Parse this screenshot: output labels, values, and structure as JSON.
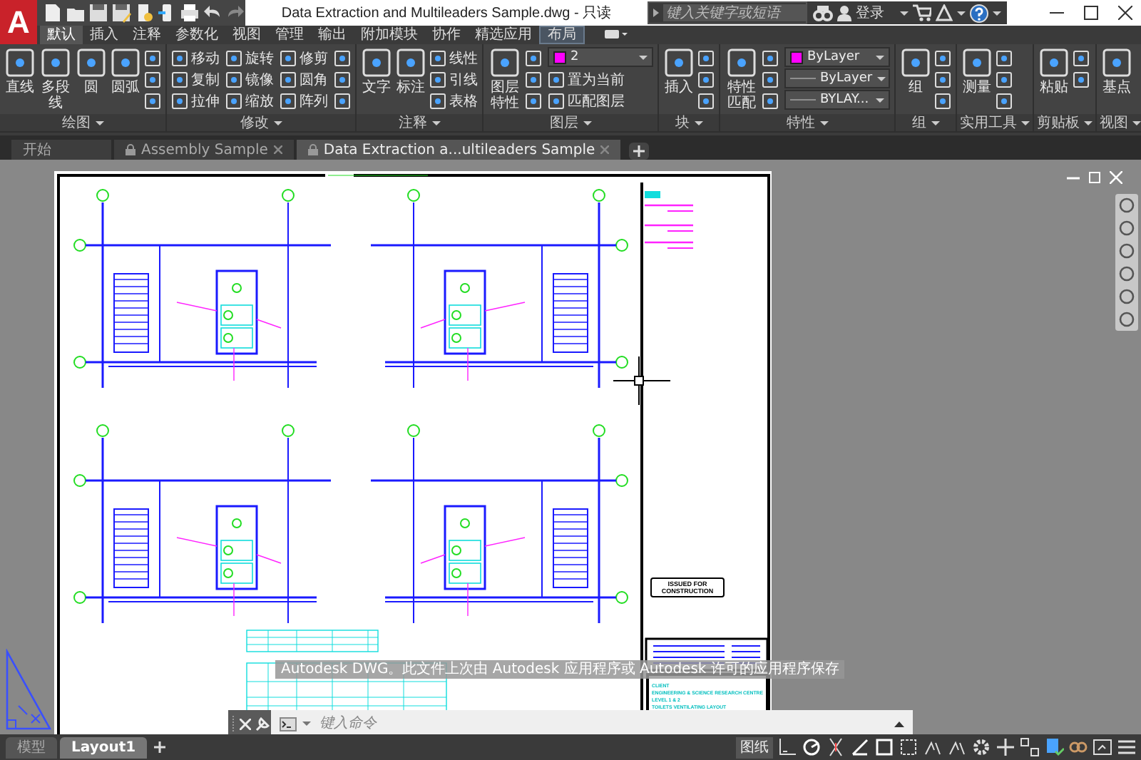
{
  "window": {
    "title": "Data Extraction and Multileaders Sample.dwg - 只读"
  },
  "app_button": {
    "label": "A"
  },
  "search": {
    "placeholder": "键入关键字或短语"
  },
  "sign_in": "登录",
  "ribbon_tabs": [
    {
      "label": "默认",
      "selected": true
    },
    {
      "label": "插入",
      "selected": false
    },
    {
      "label": "注释",
      "selected": false
    },
    {
      "label": "参数化",
      "selected": false
    },
    {
      "label": "视图",
      "selected": false
    },
    {
      "label": "管理",
      "selected": false
    },
    {
      "label": "输出",
      "selected": false
    },
    {
      "label": "附加模块",
      "selected": false
    },
    {
      "label": "协作",
      "selected": false
    },
    {
      "label": "精选应用",
      "selected": false
    },
    {
      "label": "布局",
      "selected": false,
      "contextual": true
    }
  ],
  "ribbon_panels": [
    {
      "title": "绘图",
      "tools": [
        {
          "kind": "large",
          "label": "直线"
        },
        {
          "kind": "large",
          "label": "多段线"
        },
        {
          "kind": "large",
          "label": "圆"
        },
        {
          "kind": "large",
          "label": "圆弧"
        },
        {
          "kind": "icon"
        },
        {
          "kind": "icon"
        },
        {
          "kind": "icon"
        }
      ]
    },
    {
      "title": "修改",
      "tools": [
        {
          "kind": "small",
          "label": "移动"
        },
        {
          "kind": "small",
          "label": "复制"
        },
        {
          "kind": "small",
          "label": "拉伸"
        },
        {
          "kind": "small",
          "label": "旋转"
        },
        {
          "kind": "small",
          "label": "镜像"
        },
        {
          "kind": "small",
          "label": "缩放"
        },
        {
          "kind": "small",
          "label": "修剪"
        },
        {
          "kind": "small",
          "label": "圆角"
        },
        {
          "kind": "small",
          "label": "阵列"
        },
        {
          "kind": "icon"
        },
        {
          "kind": "icon"
        },
        {
          "kind": "icon"
        }
      ]
    },
    {
      "title": "注释",
      "tools": [
        {
          "kind": "large",
          "label": "文字"
        },
        {
          "kind": "large",
          "label": "标注"
        },
        {
          "kind": "small",
          "label": "线性"
        },
        {
          "kind": "small",
          "label": "引线"
        },
        {
          "kind": "small",
          "label": "表格"
        }
      ]
    },
    {
      "title": "图层",
      "tools": [
        {
          "kind": "large",
          "label": "图层特性"
        },
        {
          "kind": "icon"
        },
        {
          "kind": "icon"
        },
        {
          "kind": "icon"
        },
        {
          "kind": "dropdown",
          "value": "2",
          "color": "#ff00ff"
        },
        {
          "kind": "small",
          "label": "置为当前"
        },
        {
          "kind": "small",
          "label": "匹配图层"
        }
      ]
    },
    {
      "title": "块",
      "tools": [
        {
          "kind": "large",
          "label": "插入"
        },
        {
          "kind": "icon"
        },
        {
          "kind": "icon"
        },
        {
          "kind": "icon"
        }
      ]
    },
    {
      "title": "特性",
      "tools": [
        {
          "kind": "large",
          "label": "特性匹配"
        },
        {
          "kind": "icon"
        },
        {
          "kind": "icon"
        },
        {
          "kind": "icon"
        },
        {
          "kind": "dropdown",
          "value": "ByLayer",
          "color": "#ff00ff"
        },
        {
          "kind": "dropdown",
          "value": "ByLayer"
        },
        {
          "kind": "dropdown",
          "value": "BYLAY..."
        }
      ]
    },
    {
      "title": "组",
      "tools": [
        {
          "kind": "large",
          "label": "组"
        },
        {
          "kind": "icon"
        },
        {
          "kind": "icon"
        },
        {
          "kind": "icon"
        }
      ]
    },
    {
      "title": "实用工具",
      "tools": [
        {
          "kind": "large",
          "label": "测量"
        },
        {
          "kind": "icon"
        },
        {
          "kind": "icon"
        },
        {
          "kind": "icon"
        }
      ]
    },
    {
      "title": "剪贴板",
      "tools": [
        {
          "kind": "large",
          "label": "粘贴"
        },
        {
          "kind": "icon"
        },
        {
          "kind": "icon"
        }
      ]
    },
    {
      "title": "视图",
      "tools": [
        {
          "kind": "large",
          "label": "基点"
        }
      ]
    }
  ],
  "document_tabs": [
    {
      "label": "开始",
      "selected": false,
      "locked": false
    },
    {
      "label": "Assembly Sample",
      "selected": false,
      "locked": true
    },
    {
      "label": "Data Extraction a...ultileaders Sample",
      "selected": true,
      "locked": true
    }
  ],
  "drawing": {
    "stamp": "ISSUED FOR CONSTRUCTION",
    "title_block": [
      "CLIENT",
      "ENGINEERING & SCIENCE RESEARCH CENTRE",
      "LEVEL 1 & 2",
      "TOILETS VENTILATING LAYOUT"
    ]
  },
  "notice": "Autodesk DWG。此文件上次由 Autodesk 应用程序或 Autodesk 许可的应用程序保存",
  "command_line": {
    "placeholder": "键入命令"
  },
  "layout_tabs": [
    {
      "label": "模型",
      "selected": false
    },
    {
      "label": "Layout1",
      "selected": true
    }
  ],
  "status_bar": {
    "space": "图纸"
  }
}
